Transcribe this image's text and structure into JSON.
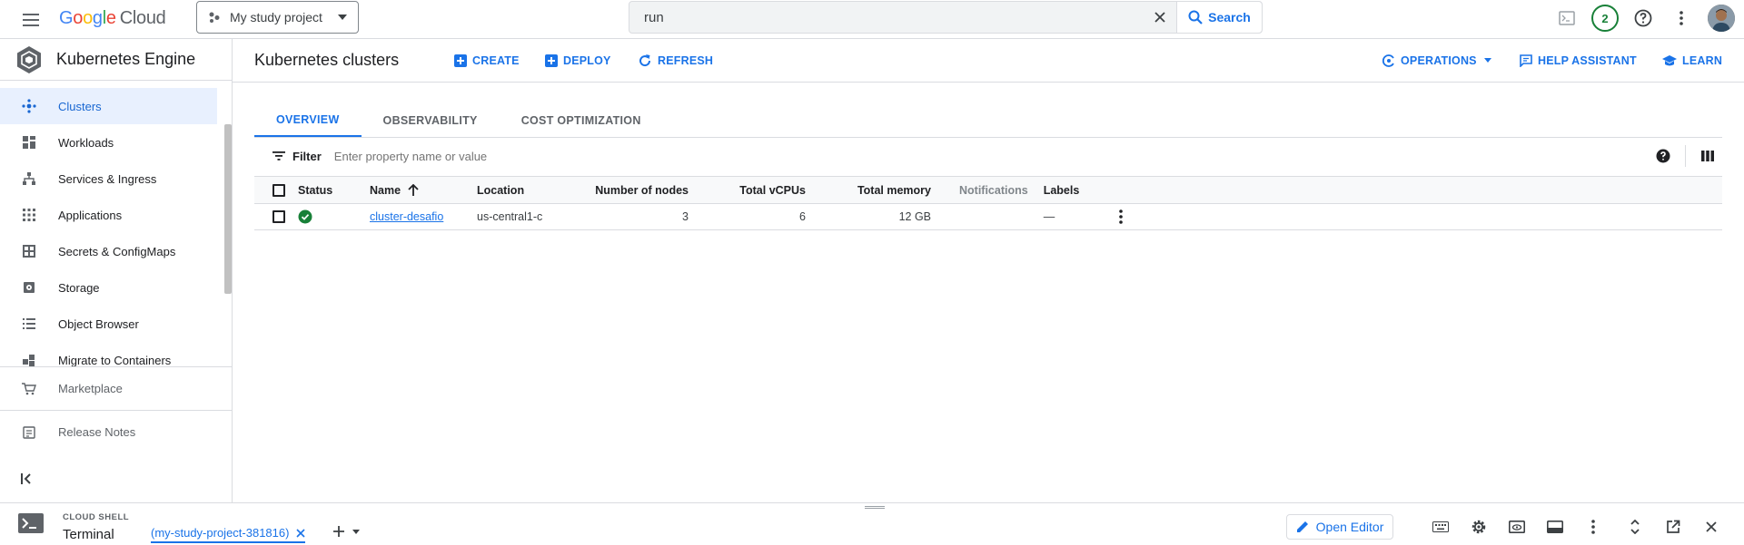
{
  "topbar": {
    "logo": {
      "g1": "G",
      "g2": "o",
      "g3": "o",
      "g1b": "g",
      "g4": "l",
      "g2b": "e",
      "product": "Cloud"
    },
    "project": "My study project",
    "search": {
      "value": "run",
      "button": "Search"
    },
    "notification_count": "2"
  },
  "sidebar": {
    "title": "Kubernetes Engine",
    "items": [
      {
        "label": "Clusters",
        "icon": "clusters-icon"
      },
      {
        "label": "Workloads",
        "icon": "workloads-icon"
      },
      {
        "label": "Services & Ingress",
        "icon": "services-icon"
      },
      {
        "label": "Applications",
        "icon": "apps-icon"
      },
      {
        "label": "Secrets & ConfigMaps",
        "icon": "secrets-icon"
      },
      {
        "label": "Storage",
        "icon": "storage-icon"
      },
      {
        "label": "Object Browser",
        "icon": "object-browser-icon"
      },
      {
        "label": "Migrate to Containers",
        "icon": "migrate-icon"
      }
    ],
    "marketplace": "Marketplace",
    "release_notes": "Release Notes"
  },
  "main": {
    "title": "Kubernetes clusters",
    "actions": {
      "create": "CREATE",
      "deploy": "DEPLOY",
      "refresh": "REFRESH",
      "operations": "OPERATIONS",
      "help_assistant": "HELP ASSISTANT",
      "learn": "LEARN"
    },
    "tabs": [
      "OVERVIEW",
      "OBSERVABILITY",
      "COST OPTIMIZATION"
    ],
    "filter": {
      "label": "Filter",
      "placeholder": "Enter property name or value"
    },
    "table": {
      "headers": {
        "status": "Status",
        "name": "Name",
        "location": "Location",
        "nodes": "Number of nodes",
        "vcpus": "Total vCPUs",
        "memory": "Total memory",
        "notifications": "Notifications",
        "labels": "Labels"
      },
      "rows": [
        {
          "name": "cluster-desafio",
          "location": "us-central1-c",
          "nodes": "3",
          "vcpus": "6",
          "memory": "12 GB",
          "notifications": "",
          "labels": "—"
        }
      ]
    }
  },
  "shell": {
    "label": "CLOUD SHELL",
    "terminal": "Terminal",
    "tab": "(my-study-project-381816)",
    "open_editor": "Open Editor"
  },
  "colors": {
    "accent": "#1a73e8",
    "success": "#188038",
    "active_bg": "#e8f0fe"
  }
}
